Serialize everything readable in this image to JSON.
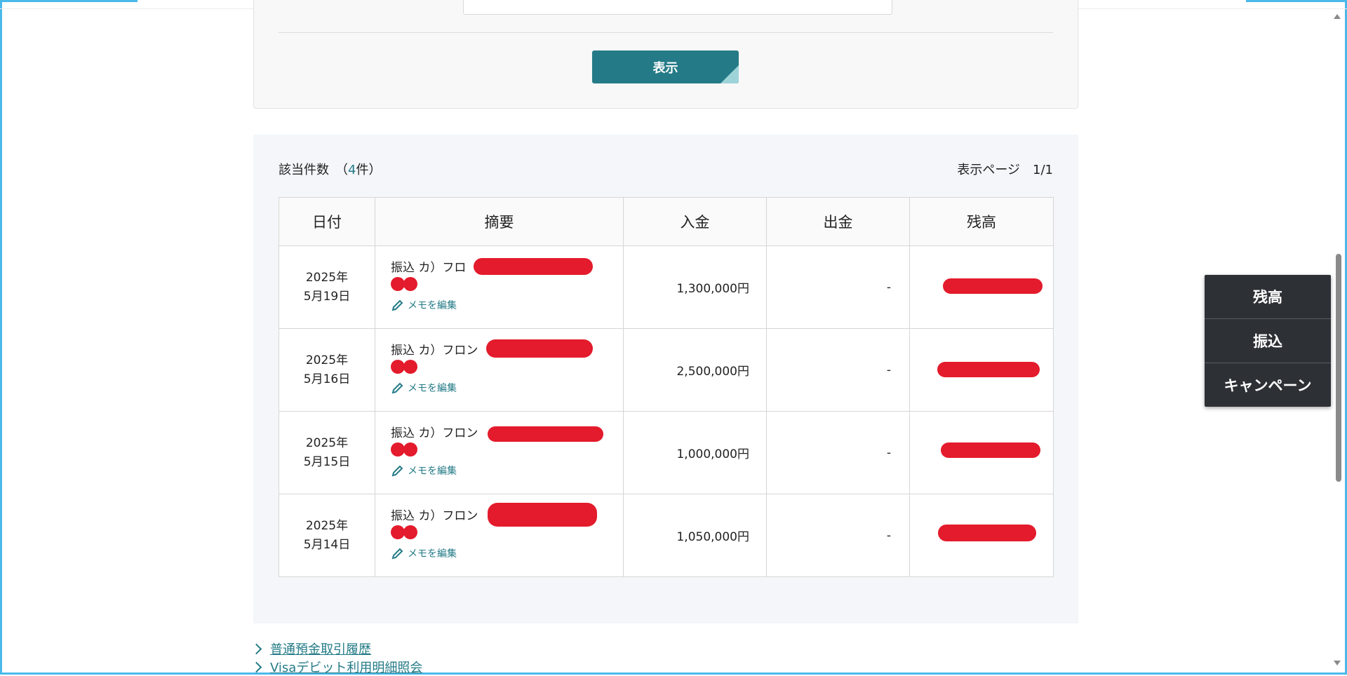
{
  "search": {
    "show_button_label": "表示"
  },
  "results": {
    "count_prefix": "該当件数　（",
    "count": "4",
    "count_suffix": "件）",
    "page_label": "表示ページ　1/1",
    "columns": [
      "日付",
      "摘要",
      "入金",
      "出金",
      "残高"
    ],
    "memo_label": "メモを編集",
    "rows": [
      {
        "year": "2025年",
        "day": "5月19日",
        "summary": "振込 カ）フロ",
        "deposit": "1,300,000円",
        "withdrawal": "-"
      },
      {
        "year": "2025年",
        "day": "5月16日",
        "summary": "振込 カ）フロン",
        "deposit": "2,500,000円",
        "withdrawal": "-"
      },
      {
        "year": "2025年",
        "day": "5月15日",
        "summary": "振込 カ）フロン",
        "deposit": "1,000,000円",
        "withdrawal": "-"
      },
      {
        "year": "2025年",
        "day": "5月14日",
        "summary": "振込 カ）フロン",
        "deposit": "1,050,000円",
        "withdrawal": "-"
      }
    ]
  },
  "links": [
    {
      "label": "普通預金取引履歴"
    },
    {
      "label": "Visaデビット利用明細照会"
    }
  ],
  "float_menu": [
    {
      "label": "残高"
    },
    {
      "label": "振込"
    },
    {
      "label": "キャンペーン"
    }
  ],
  "colors": {
    "accent": "#247b87",
    "redaction": "#e31b2c",
    "menu_bg": "#2d3035",
    "window_border": "#4ab9ea"
  },
  "icons": {
    "memo": "pencil-icon",
    "link": "chevron-right-icon"
  }
}
